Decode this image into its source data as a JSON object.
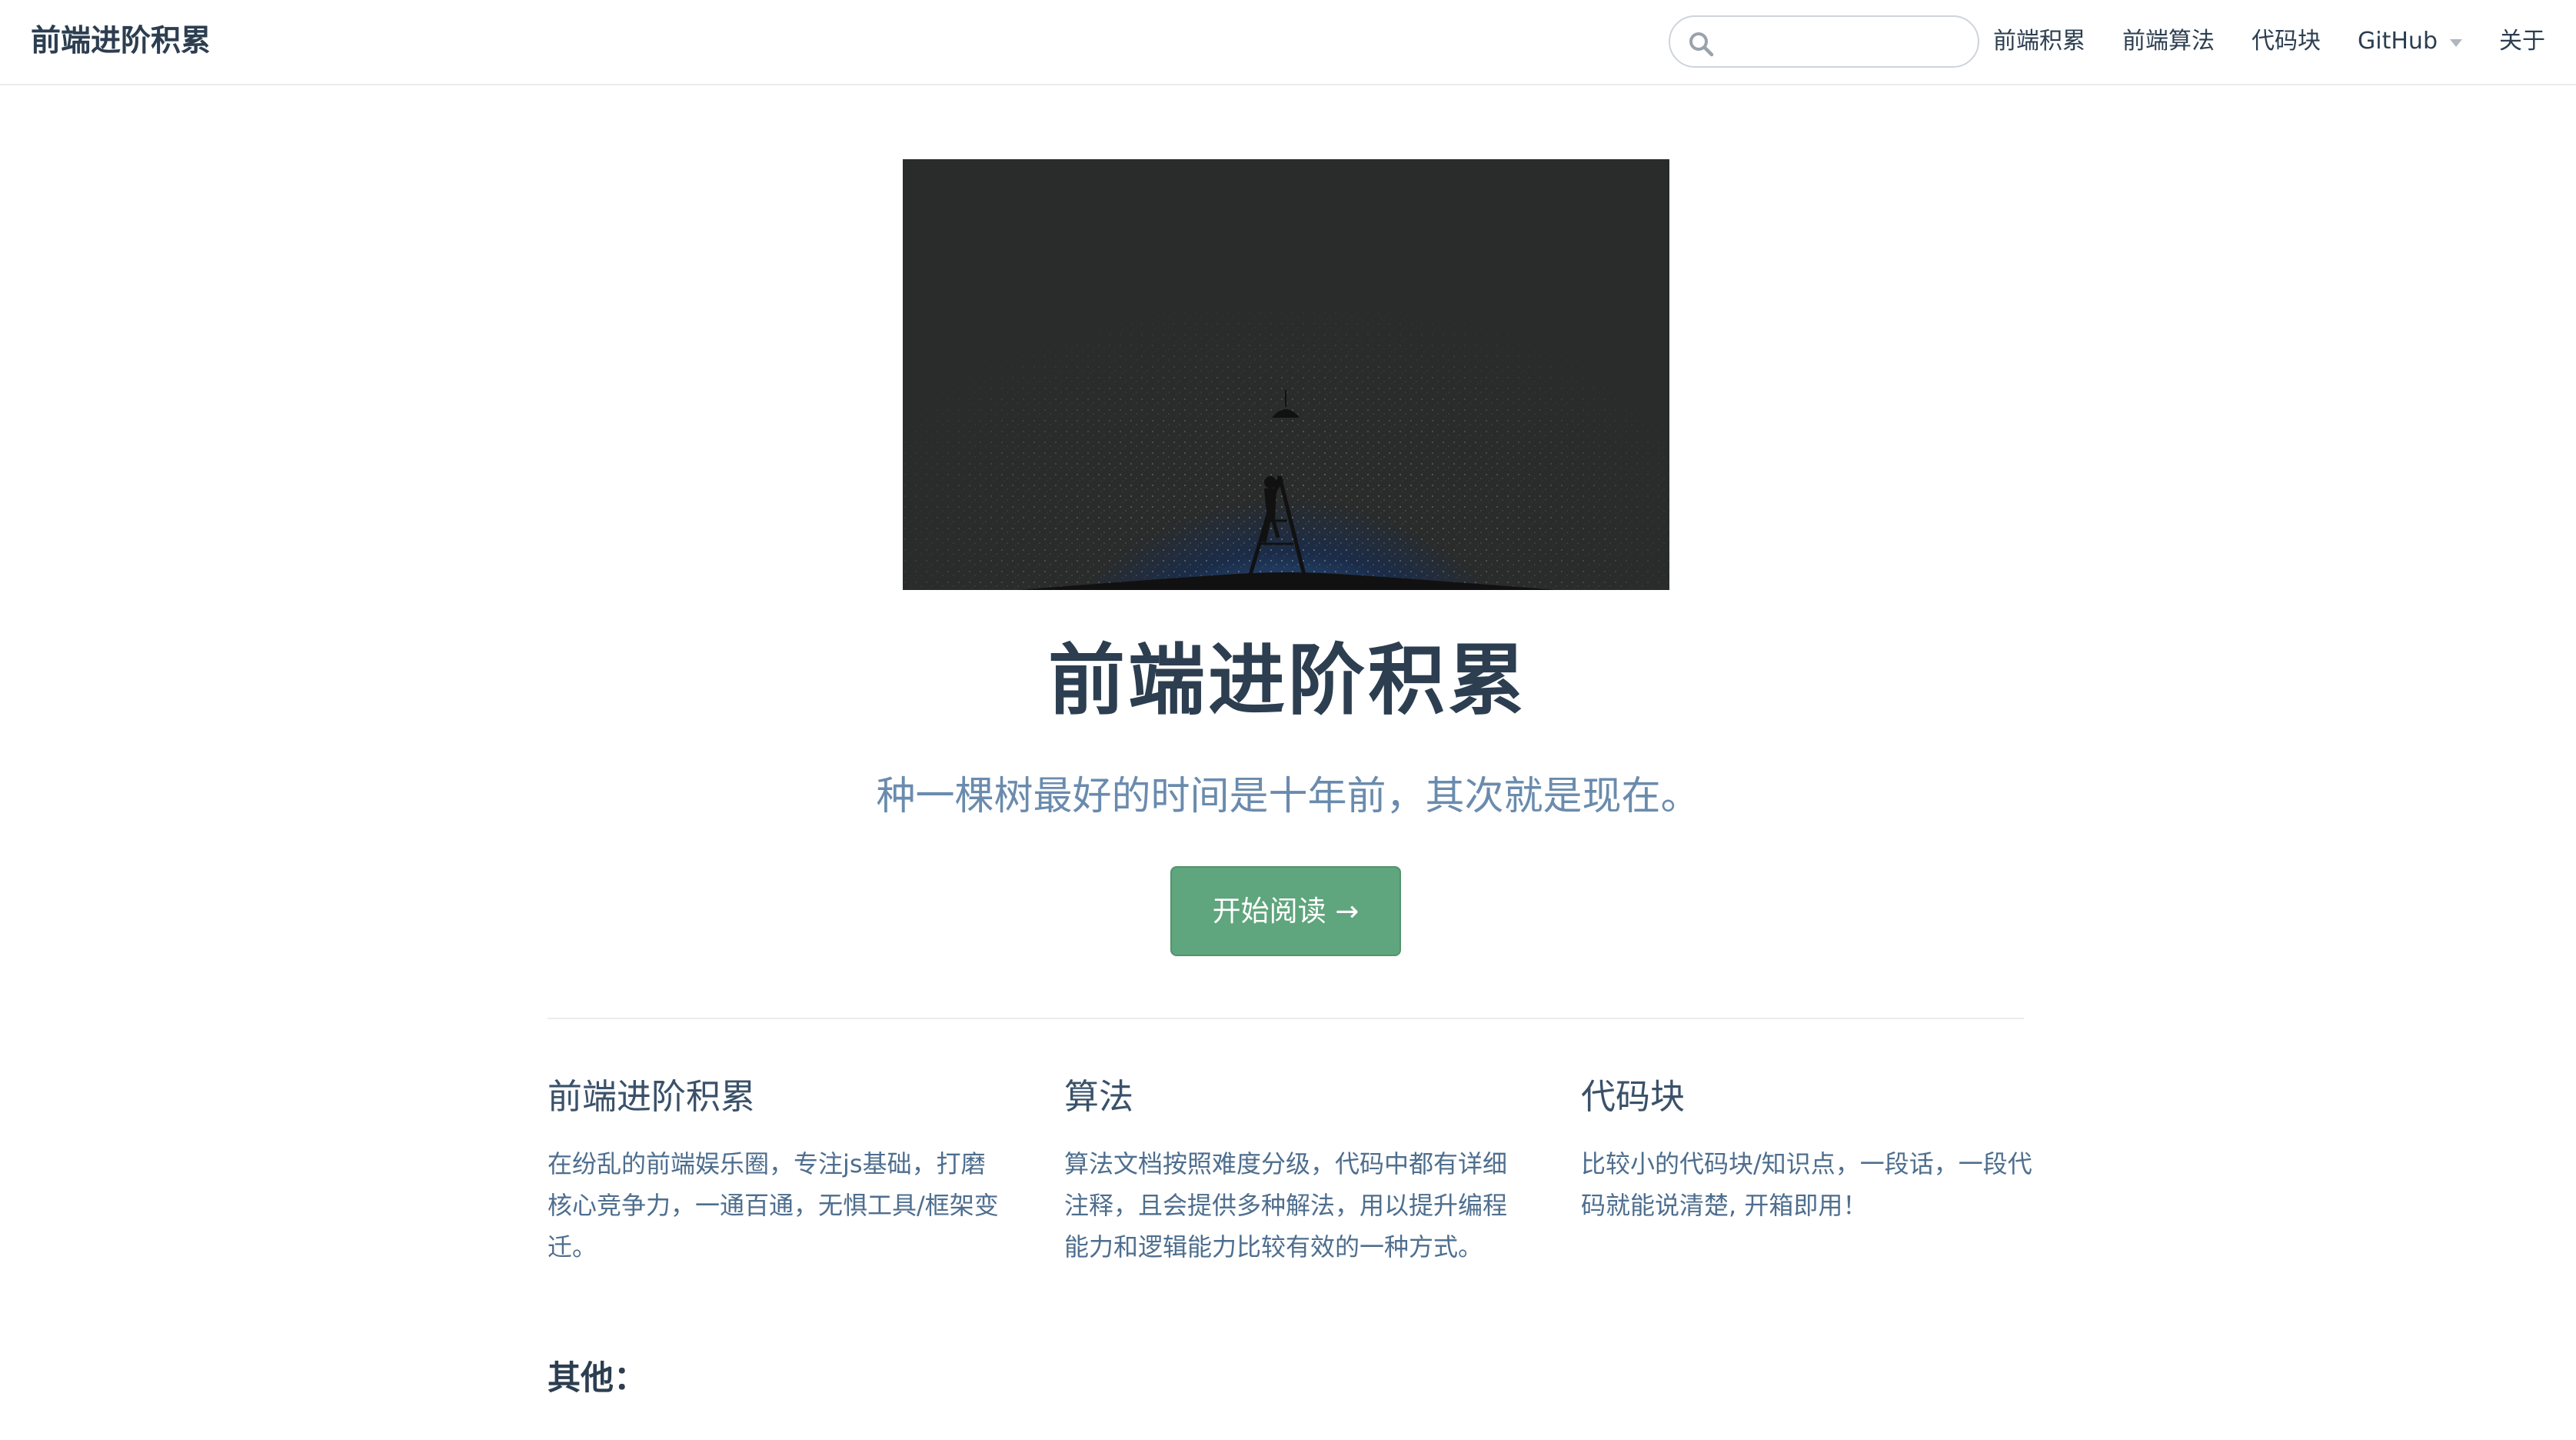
{
  "navbar": {
    "site_name": "前端进阶积累",
    "search": {
      "value": "",
      "placeholder": ""
    },
    "links": [
      {
        "label": "前端积累"
      },
      {
        "label": "前端算法"
      },
      {
        "label": "代码块"
      },
      {
        "label": "GitHub",
        "has_dropdown": true
      },
      {
        "label": "关于"
      }
    ]
  },
  "hero": {
    "image_alt": "hero-image-starry-night-ladder-lamp",
    "title": "前端进阶积累",
    "description": "种一棵树最好的时间是十年前，其次就是现在。",
    "action_label": "开始阅读 →"
  },
  "features": [
    {
      "title": "前端进阶积累",
      "details": "在纷乱的前端娱乐圈，专注js基础，打磨核心竞争力，一通百通，无惧工具/框架变迁。"
    },
    {
      "title": "算法",
      "details": "算法文档按照难度分级，代码中都有详细注释，且会提供多种解法，用以提升编程能力和逻辑能力比较有效的一种方式。"
    },
    {
      "title": "代码块",
      "details": "比较小的代码块/知识点，一段话，一段代码就能说清楚, 开箱即用！"
    }
  ],
  "other": {
    "title": "其他："
  },
  "colors": {
    "accent": "#5fa57d",
    "text": "#2c3e50",
    "desc": "#6a8bad",
    "hero_bg": "#2a2c2b",
    "starlight": "#9cc6e4"
  }
}
